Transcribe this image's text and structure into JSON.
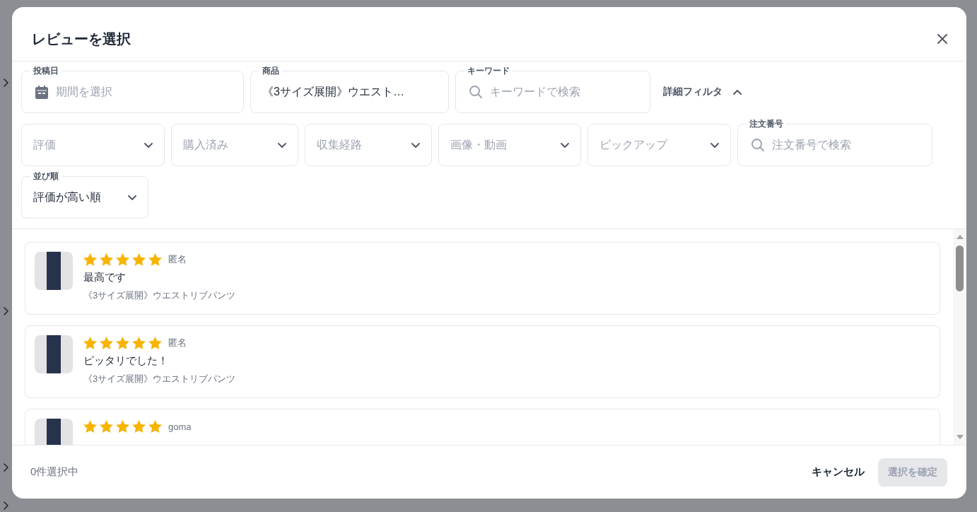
{
  "dialog": {
    "title": "レビューを選択"
  },
  "primary_filters": [
    {
      "kind": "date",
      "label": "投稿日",
      "placeholder": "期間を選択"
    },
    {
      "kind": "select",
      "label": "商品",
      "value": "《3サイズ展開》ウエスト…"
    },
    {
      "kind": "search",
      "label": "キーワード",
      "placeholder": "キーワードで検索"
    }
  ],
  "detail_filter": {
    "label": "詳細フィルタ",
    "expanded": true
  },
  "detail_filters": [
    {
      "kind": "dropdown",
      "placeholder": "評価"
    },
    {
      "kind": "dropdown",
      "placeholder": "購入済み"
    },
    {
      "kind": "dropdown",
      "placeholder": "収集経路"
    },
    {
      "kind": "dropdown",
      "placeholder": "画像・動画"
    },
    {
      "kind": "dropdown",
      "placeholder": "ピックアップ"
    },
    {
      "kind": "search",
      "label": "注文番号",
      "placeholder": "注文番号で検索"
    }
  ],
  "sort": {
    "label": "並び順",
    "value": "評価が高い順"
  },
  "reviews": [
    {
      "stars": 5,
      "author": "匿名",
      "comment": "最高です",
      "product": "《3サイズ展開》ウエストリブパンツ",
      "selected": false
    },
    {
      "stars": 5,
      "author": "匿名",
      "comment": "ピッタリでした！",
      "product": "《3サイズ展開》ウエストリブパンツ",
      "selected": false
    },
    {
      "stars": 5,
      "author": "goma",
      "selected": false
    }
  ],
  "footer": {
    "selection_count": "0件選択中",
    "cancel": "キャンセル",
    "confirm": {
      "label": "選択を確定",
      "disabled": true
    }
  }
}
